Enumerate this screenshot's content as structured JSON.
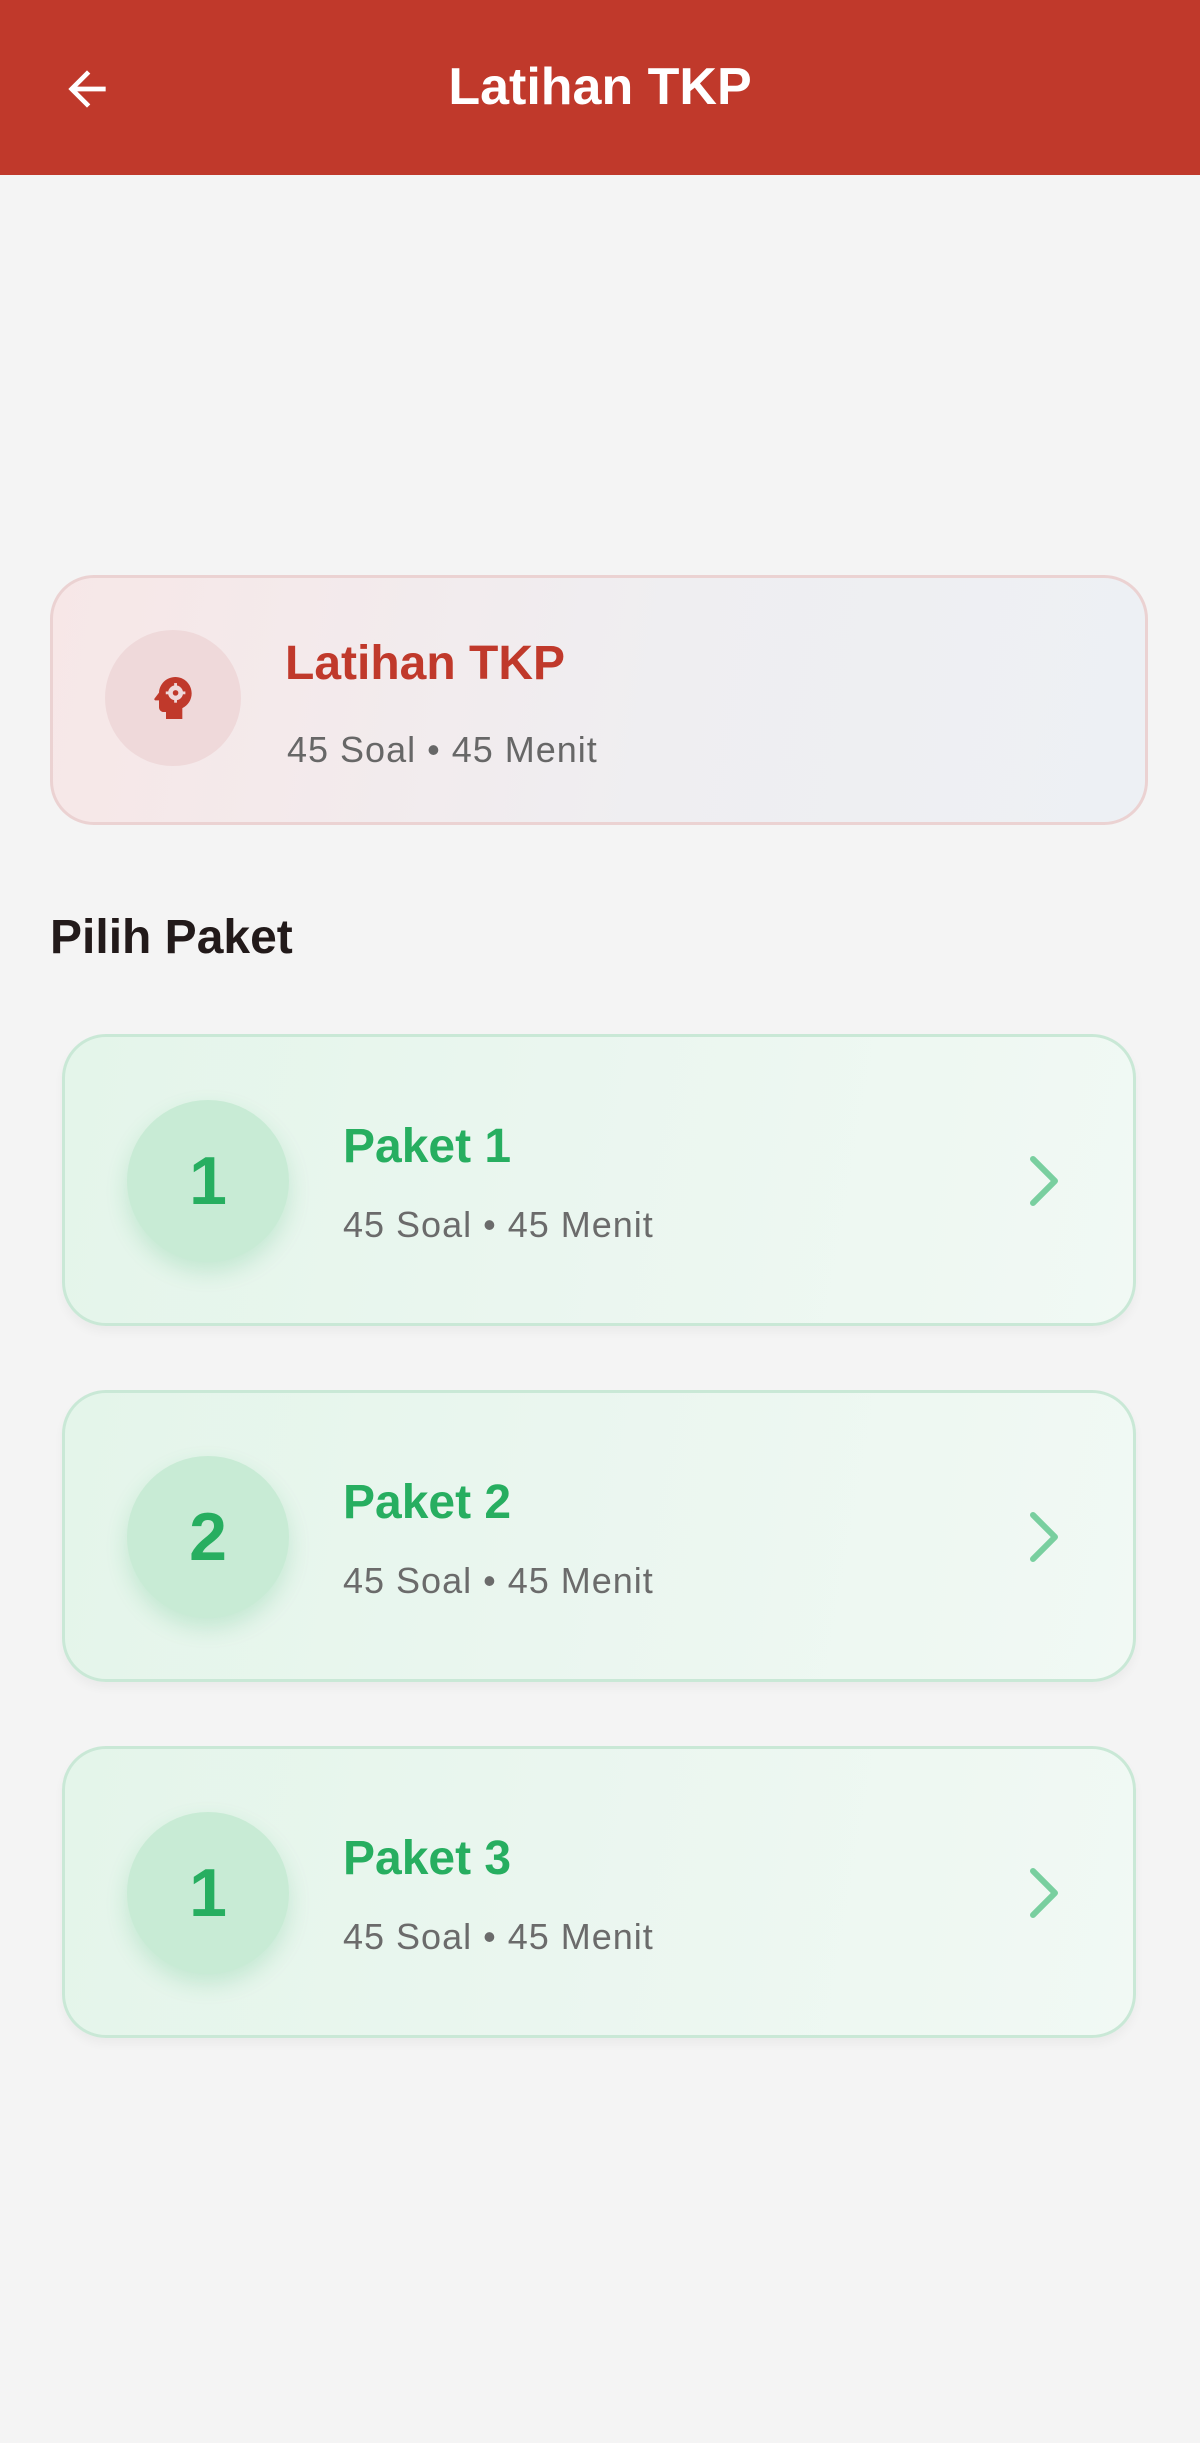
{
  "appbar": {
    "title": "Latihan TKP",
    "back_icon": "arrow-left-icon"
  },
  "summary": {
    "icon": "head-gear-icon",
    "title": "Latihan TKP",
    "subtitle": "45 Soal • 45 Menit"
  },
  "section": {
    "title": "Pilih Paket"
  },
  "packages": [
    {
      "number": "1",
      "title": "Paket 1",
      "subtitle": "45 Soal • 45 Menit"
    },
    {
      "number": "2",
      "title": "Paket 2",
      "subtitle": "45 Soal • 45 Menit"
    },
    {
      "number": "1",
      "title": "Paket 3",
      "subtitle": "45 Soal • 45 Menit"
    }
  ],
  "colors": {
    "primary": "#c0392b",
    "success": "#27ae60",
    "background": "#f4f4f4"
  }
}
